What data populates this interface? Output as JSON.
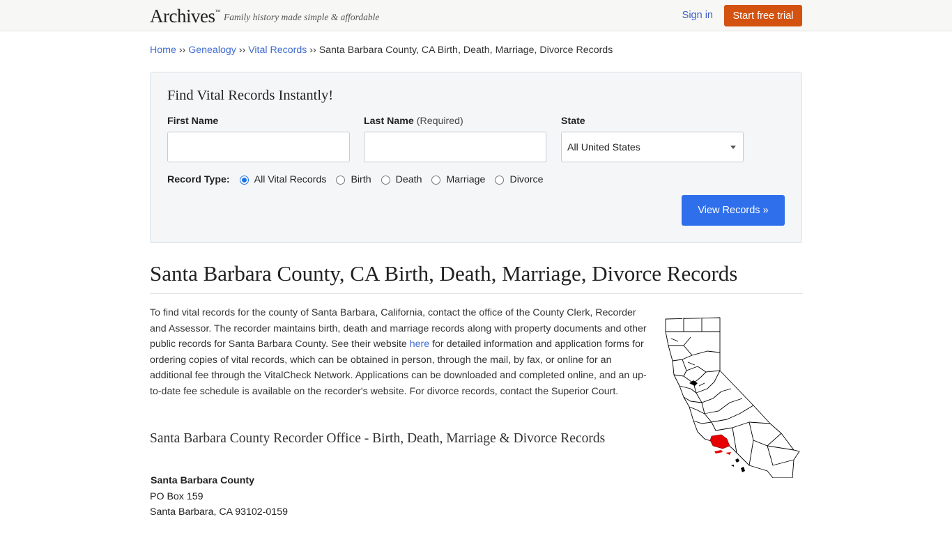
{
  "header": {
    "logo": "Archives",
    "logo_tm": "™",
    "tagline": "Family history made simple & affordable",
    "signin": "Sign in",
    "trial": "Start free trial"
  },
  "breadcrumb": {
    "items": [
      "Home",
      "Genealogy",
      "Vital Records"
    ],
    "separator": "››",
    "current": "Santa Barbara County, CA Birth, Death, Marriage, Divorce Records"
  },
  "search": {
    "title": "Find Vital Records Instantly!",
    "first_name_label": "First Name",
    "last_name_label": "Last Name",
    "last_name_required": "(Required)",
    "state_label": "State",
    "first_name_value": "",
    "last_name_value": "",
    "state_value": "All United States",
    "record_type_label": "Record Type:",
    "record_types": [
      "All Vital Records",
      "Birth",
      "Death",
      "Marriage",
      "Divorce"
    ],
    "selected_record_type": "All Vital Records",
    "submit": "View Records »"
  },
  "main": {
    "title": "Santa Barbara County, CA Birth, Death, Marriage, Divorce Records",
    "intro_before_link": "To find vital records for the county of Santa Barbara, California, contact the office of the County Clerk, Recorder and Assessor. The recorder maintains birth, death and marriage records along with property documents and other public records for Santa Barbara County. See their website ",
    "intro_link": "here",
    "intro_after_link": " for detailed information and application forms for ordering copies of vital records, which can be obtained in person, through the mail, by fax, or online for an additional fee through the VitalCheck Network. Applications can be downloaded and completed online, and an up-to-date fee schedule is available on the recorder's website. For divorce records, contact the Superior Court.",
    "subtitle": "Santa Barbara County Recorder Office - Birth, Death, Marriage & Divorce Records",
    "address_name": "Santa Barbara County",
    "address_line1": "PO Box 159",
    "address_line2": "Santa Barbara, CA 93102-0159"
  },
  "map": {
    "highlight_color": "#e60000",
    "outline_color": "#000000",
    "icon": "california-county-map"
  },
  "colors": {
    "link": "#3f6bcf",
    "trial_button": "#d4520f",
    "view_button": "#2f6fec",
    "search_bg": "#f4f6f8"
  }
}
